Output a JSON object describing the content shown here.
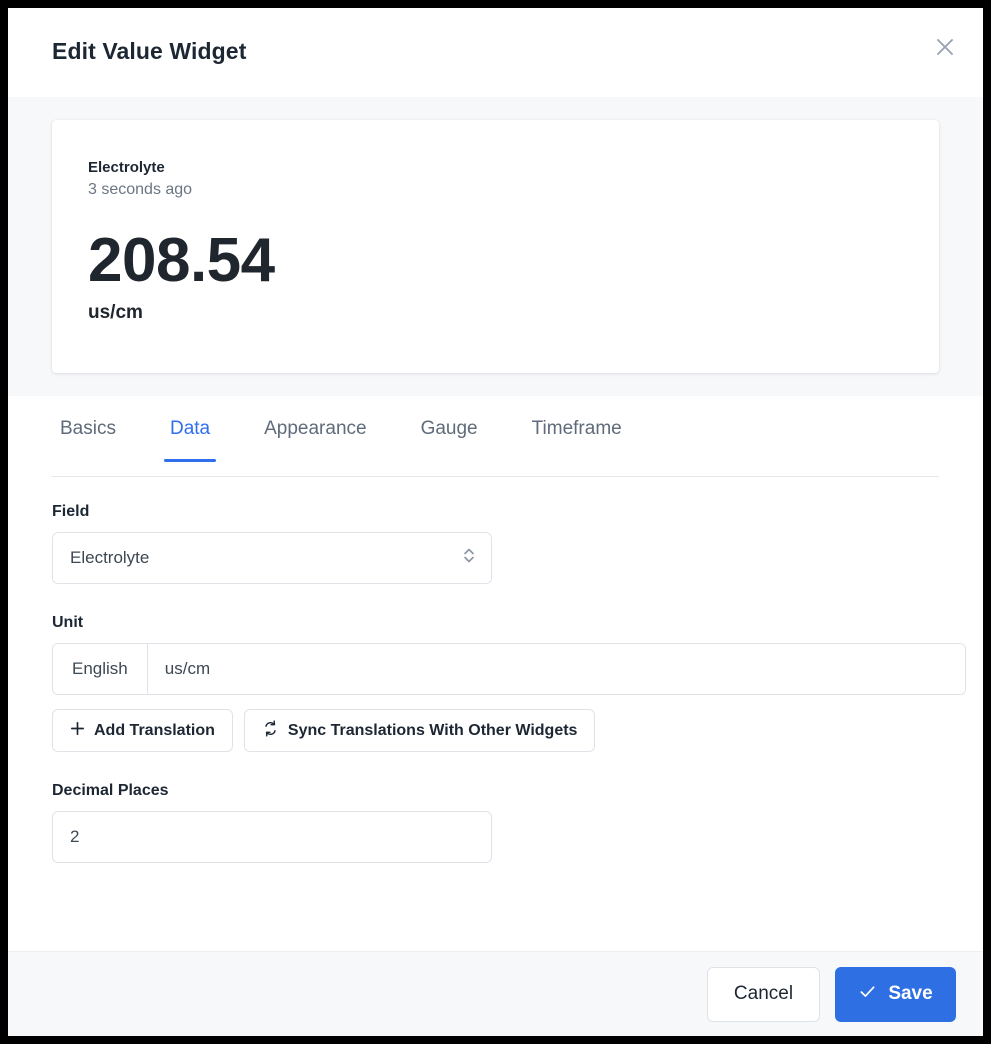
{
  "dialog": {
    "title": "Edit Value Widget",
    "close_icon": "close-icon"
  },
  "preview": {
    "name": "Electrolyte",
    "timestamp": "3 seconds ago",
    "value": "208.54",
    "unit": "us/cm"
  },
  "tabs": [
    {
      "label": "Basics",
      "active": false
    },
    {
      "label": "Data",
      "active": true
    },
    {
      "label": "Appearance",
      "active": false
    },
    {
      "label": "Gauge",
      "active": false
    },
    {
      "label": "Timeframe",
      "active": false
    }
  ],
  "form": {
    "field": {
      "label": "Field",
      "value": "Electrolyte",
      "caret_icon": "chevron-updown-icon"
    },
    "unit": {
      "label": "Unit",
      "language": "English",
      "value": "us/cm",
      "add_translation_label": "Add Translation",
      "add_translation_icon": "plus-icon",
      "sync_label": "Sync Translations With Other Widgets",
      "sync_icon": "sync-icon"
    },
    "decimal_places": {
      "label": "Decimal Places",
      "value": "2"
    }
  },
  "footer": {
    "cancel_label": "Cancel",
    "save_label": "Save",
    "save_icon": "check-icon"
  },
  "colors": {
    "accent": "#2f6fed",
    "save_button": "#2f6fe4",
    "panel_bg": "#f7f8fa",
    "border": "#dfe3e8",
    "text_primary": "#1d2733",
    "text_muted": "#6b7683"
  }
}
